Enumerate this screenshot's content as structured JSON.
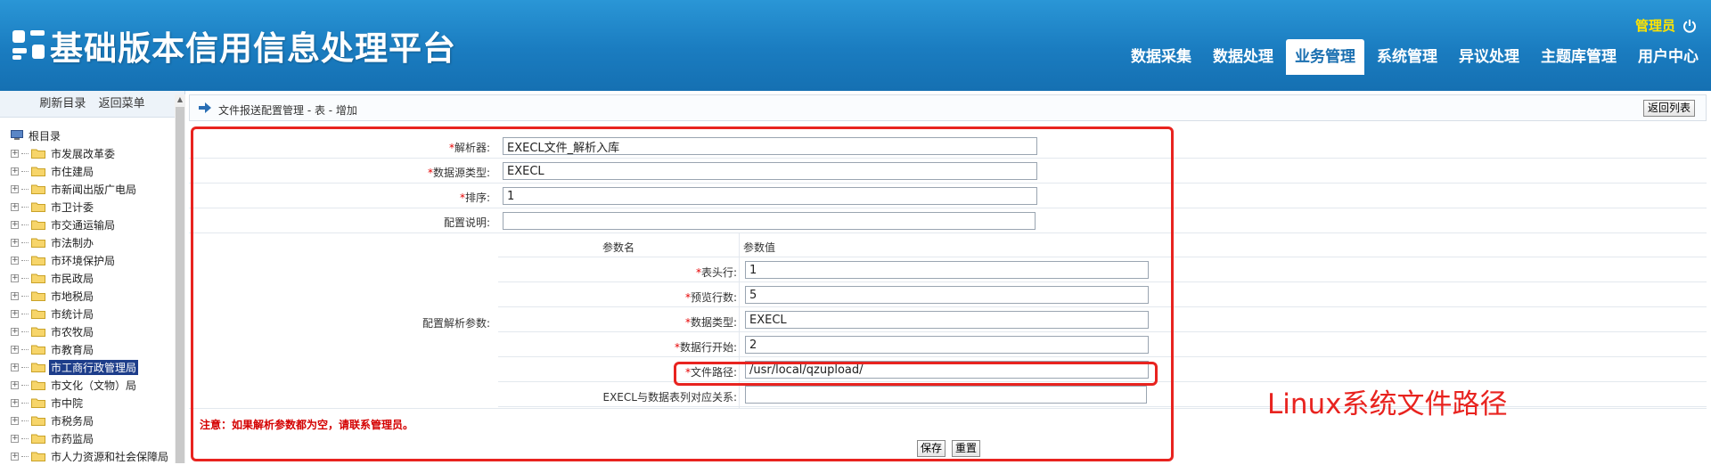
{
  "app": {
    "title": "基础版本信用信息处理平台",
    "user": "管理员"
  },
  "nav": [
    "数据采集",
    "数据处理",
    "业务管理",
    "系统管理",
    "异议处理",
    "主题库管理",
    "用户中心"
  ],
  "sidebar": {
    "refresh": "刷新目录",
    "back_menu": "返回菜单",
    "root": "根目录",
    "items": [
      "市发展改革委",
      "市住建局",
      "市新闻出版广电局",
      "市卫计委",
      "市交通运输局",
      "市法制办",
      "市环境保护局",
      "市民政局",
      "市地税局",
      "市统计局",
      "市农牧局",
      "市教育局",
      "市工商行政管理局",
      "市文化（文物）局",
      "市中院",
      "市税务局",
      "市药监局",
      "市人力资源和社会保障局"
    ],
    "selected_index": 12
  },
  "breadcrumb": "文件报送配置管理 - 表 - 增加",
  "back_button": "返回列表",
  "form": {
    "parser": {
      "label": "解析器:",
      "value": "EXECL文件_解析入库"
    },
    "datasource_type": {
      "label": "数据源类型:",
      "value": "EXECL"
    },
    "order": {
      "label": "排序:",
      "value": "1"
    },
    "description": {
      "label": "配置说明:",
      "value": ""
    },
    "params_label": "配置解析参数:",
    "params_header": {
      "name": "参数名",
      "value": "参数值"
    },
    "params": [
      {
        "label": "表头行:",
        "required": true,
        "value": "1"
      },
      {
        "label": "预览行数:",
        "required": true,
        "value": "5"
      },
      {
        "label": "数据类型:",
        "required": true,
        "value": "EXECL"
      },
      {
        "label": "数据行开始:",
        "required": true,
        "value": "2"
      },
      {
        "label": "文件路径:",
        "required": true,
        "value": "/usr/local/qzupload/"
      },
      {
        "label": "EXECL与数据表列对应关系:",
        "required": false,
        "value": ""
      }
    ],
    "note": "注意：如果解析参数都为空，请联系管理员。",
    "save": "保存",
    "reset": "重置"
  },
  "annotation": "Linux系统文件路径",
  "colors": {
    "header": "#1a7cc0",
    "annotation": "#e8231f",
    "user": "#ffe400"
  }
}
